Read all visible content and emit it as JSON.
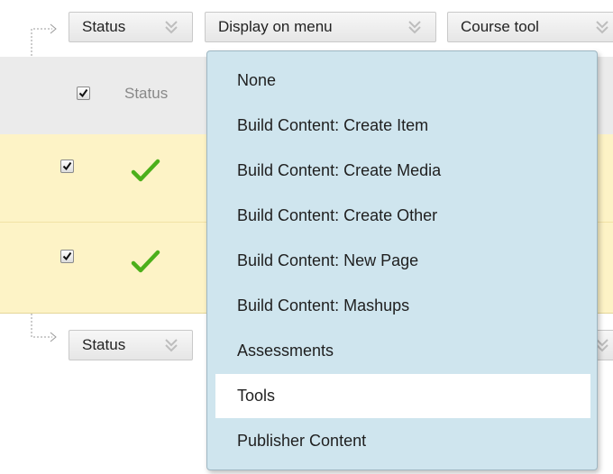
{
  "top_toolbar": {
    "status_label": "Status",
    "display_label": "Display on menu",
    "course_tool_label": "Course tool"
  },
  "table": {
    "header_status": "Status"
  },
  "bottom_toolbar": {
    "status_label": "Status"
  },
  "menu": {
    "items": [
      "None",
      "Build Content: Create Item",
      "Build Content: Create Media",
      "Build Content: Create Other",
      "Build Content: New Page",
      "Build Content: Mashups",
      "Assessments",
      "Tools",
      "Publisher Content"
    ],
    "selected": "Tools"
  },
  "colors": {
    "highlight_row": "#fdf3c6",
    "menu_bg": "#cfe5ee",
    "check": "#4caf1a"
  }
}
